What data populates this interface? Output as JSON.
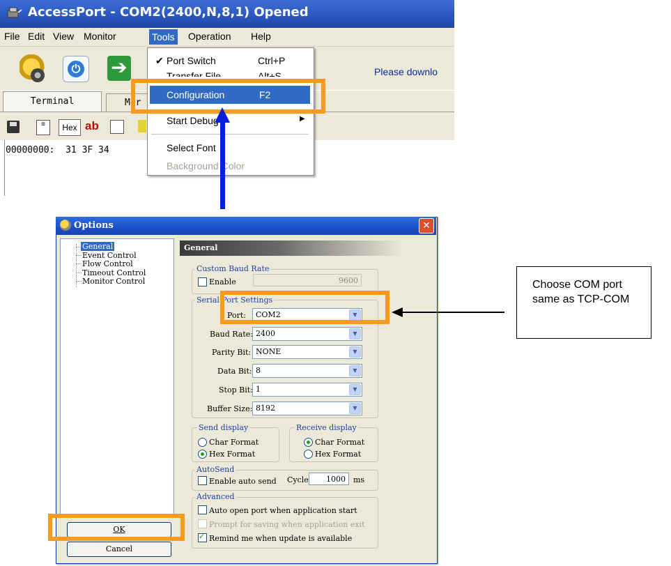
{
  "app": {
    "title": "AccessPort - COM2(2400,N,8,1) Opened",
    "menu": [
      "File",
      "Edit",
      "View",
      "Monitor",
      "Tools",
      "Operation",
      "Help"
    ],
    "notice": "Please downlo",
    "tabs": [
      "Terminal",
      "Mor"
    ],
    "hex_button": "Hex",
    "ab_button": "ab",
    "terminal_text": "00000000:  31 3F 34",
    "colors": {
      "titlebar": "#2a55bf",
      "menu_highlight": "#316ac5",
      "callout_highlight": "#f79a1e",
      "pointer_arrow": "#0a1fdc"
    }
  },
  "tools_menu": {
    "items": [
      {
        "label": "Port Switch",
        "shortcut": "Ctrl+P",
        "checked": true
      },
      {
        "label": "Transfer File",
        "shortcut": "Alt+S"
      },
      {
        "label": "Configuration",
        "shortcut": "F2",
        "highlighted": true
      },
      {
        "label": "Start Debug",
        "submenu": true
      },
      {
        "label": "Select Font"
      },
      {
        "label": "Background Color",
        "disabled": true
      }
    ]
  },
  "dialog": {
    "title": "Options",
    "tree": [
      "General",
      "Event Control",
      "Flow Control",
      "Timeout Control",
      "Monitor Control"
    ],
    "panel_title": "General",
    "custom_baud": {
      "group": "Custom Baud Rate",
      "enable_label": "Enable",
      "enabled": false,
      "value": "9600"
    },
    "serial": {
      "group": "Serial Port Settings",
      "fields": [
        {
          "label": "Port:",
          "value": "COM2"
        },
        {
          "label": "Baud Rate:",
          "value": "2400"
        },
        {
          "label": "Parity Bit:",
          "value": "NONE"
        },
        {
          "label": "Data Bit:",
          "value": "8"
        },
        {
          "label": "Stop Bit:",
          "value": "1"
        },
        {
          "label": "Buffer Size:",
          "value": "8192"
        }
      ]
    },
    "send_display": {
      "group": "Send display",
      "options": [
        "Char Format",
        "Hex Format"
      ],
      "selected": "Hex Format"
    },
    "receive_display": {
      "group": "Receive display",
      "options": [
        "Char Format",
        "Hex  Format"
      ],
      "selected": "Char Format"
    },
    "autosend": {
      "group": "AutoSend",
      "enable_label": "Enable auto send",
      "enabled": false,
      "cycle_label": "Cycle",
      "cycle_value": "1000",
      "unit": "ms"
    },
    "advanced": {
      "group": "Advanced",
      "options": [
        {
          "label": "Auto open port when application start",
          "checked": false,
          "disabled": false
        },
        {
          "label": "Prompt for saving when application exit",
          "checked": false,
          "disabled": true
        },
        {
          "label": "Remind me when update is available",
          "checked": true,
          "disabled": false
        }
      ]
    },
    "ok_label": "OK",
    "cancel_label": "Cancel"
  },
  "callout": {
    "text": "Choose COM port same as TCP-COM"
  }
}
